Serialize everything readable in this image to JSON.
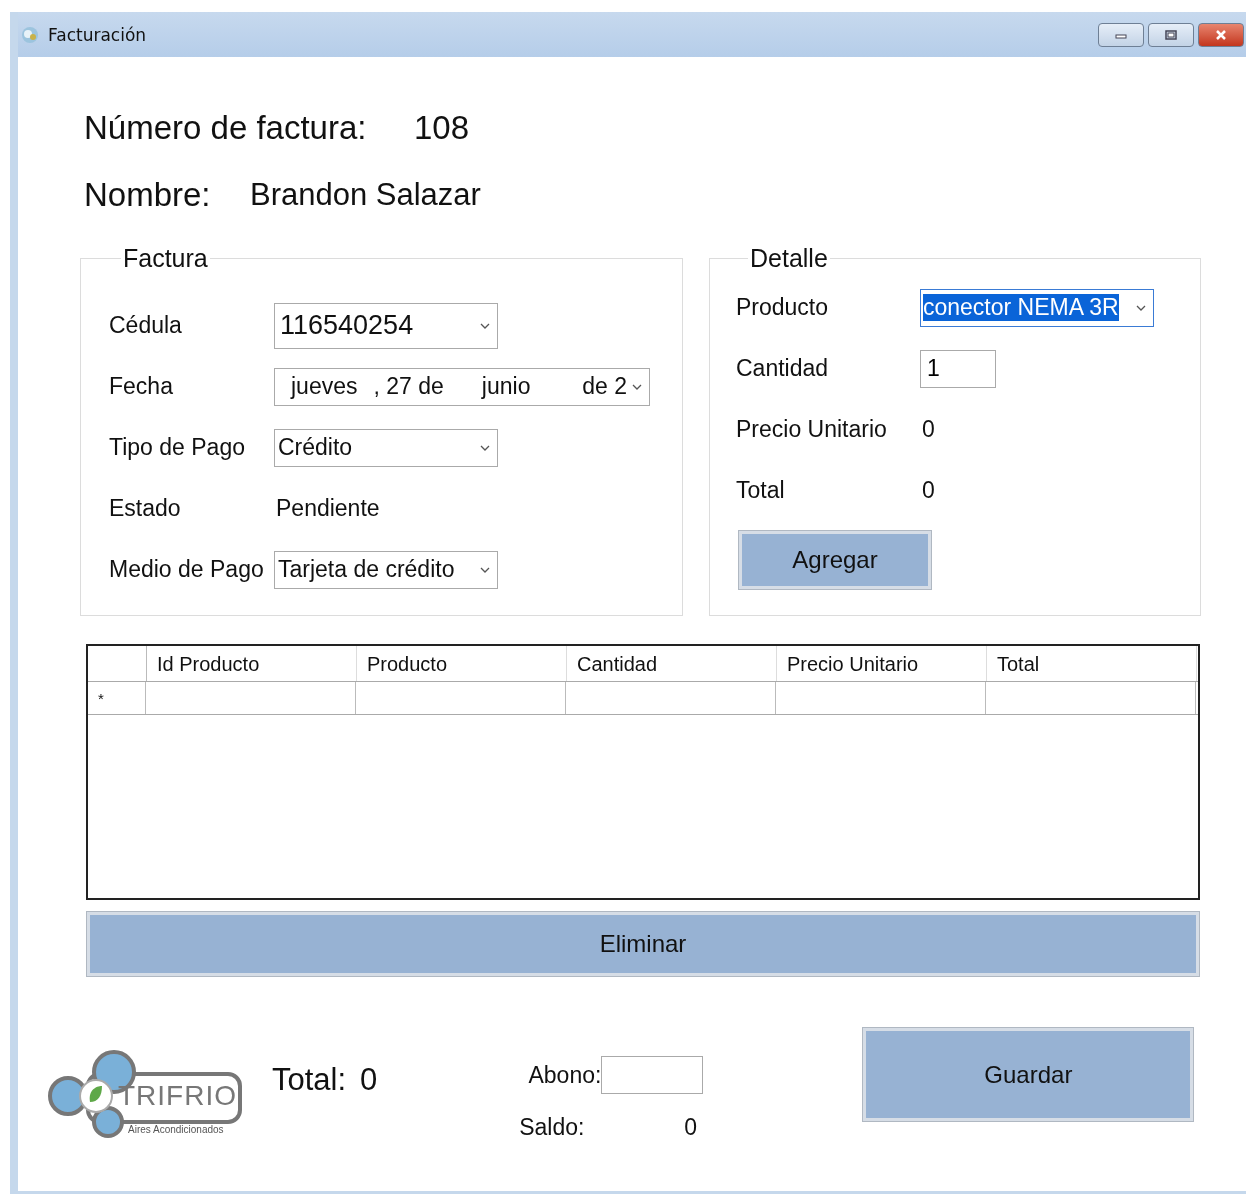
{
  "window": {
    "title": "Facturación"
  },
  "header": [
    {
      "label": "Número de factura:",
      "value": "108"
    },
    {
      "label": "Nombre:",
      "value": "Brandon Salazar"
    }
  ],
  "factura": {
    "title": "Factura",
    "fields": [
      {
        "label": "Cédula",
        "kind": "combo",
        "value": "116540254",
        "large": true
      },
      {
        "label": "Fecha",
        "kind": "date",
        "parts": [
          "jueves",
          ", 27 de",
          "junio",
          "de 2"
        ]
      },
      {
        "label": "Tipo de Pago",
        "kind": "combo",
        "value": "Crédito",
        "large": false
      },
      {
        "label": "Estado",
        "kind": "text",
        "value": "Pendiente"
      },
      {
        "label": "Medio de Pago",
        "kind": "combo",
        "value": "Tarjeta de crédito",
        "large": false
      }
    ]
  },
  "detalle": {
    "title": "Detalle",
    "fields": [
      {
        "label": "Producto",
        "kind": "combo",
        "value": "conector NEMA 3R",
        "text_selected": true
      },
      {
        "label": "Cantidad",
        "kind": "input",
        "value": "1"
      },
      {
        "label": "Precio Unitario",
        "kind": "text",
        "value": "0"
      },
      {
        "label": "Total",
        "kind": "text",
        "value": "0"
      }
    ],
    "button": "Agregar"
  },
  "table": {
    "columns": [
      "Id Producto",
      "Producto",
      "Cantidad",
      "Precio Unitario",
      "Total"
    ],
    "new_row_marker": "*"
  },
  "delete_button": "Eliminar",
  "logo": {
    "name": "TRIFRIO",
    "tagline": "Aires Acondicionados"
  },
  "total": {
    "label": "Total:",
    "value": "0"
  },
  "abono": {
    "label": "Abono:"
  },
  "saldo": {
    "label": "Saldo:",
    "value": "0"
  },
  "save_button": "Guardar"
}
